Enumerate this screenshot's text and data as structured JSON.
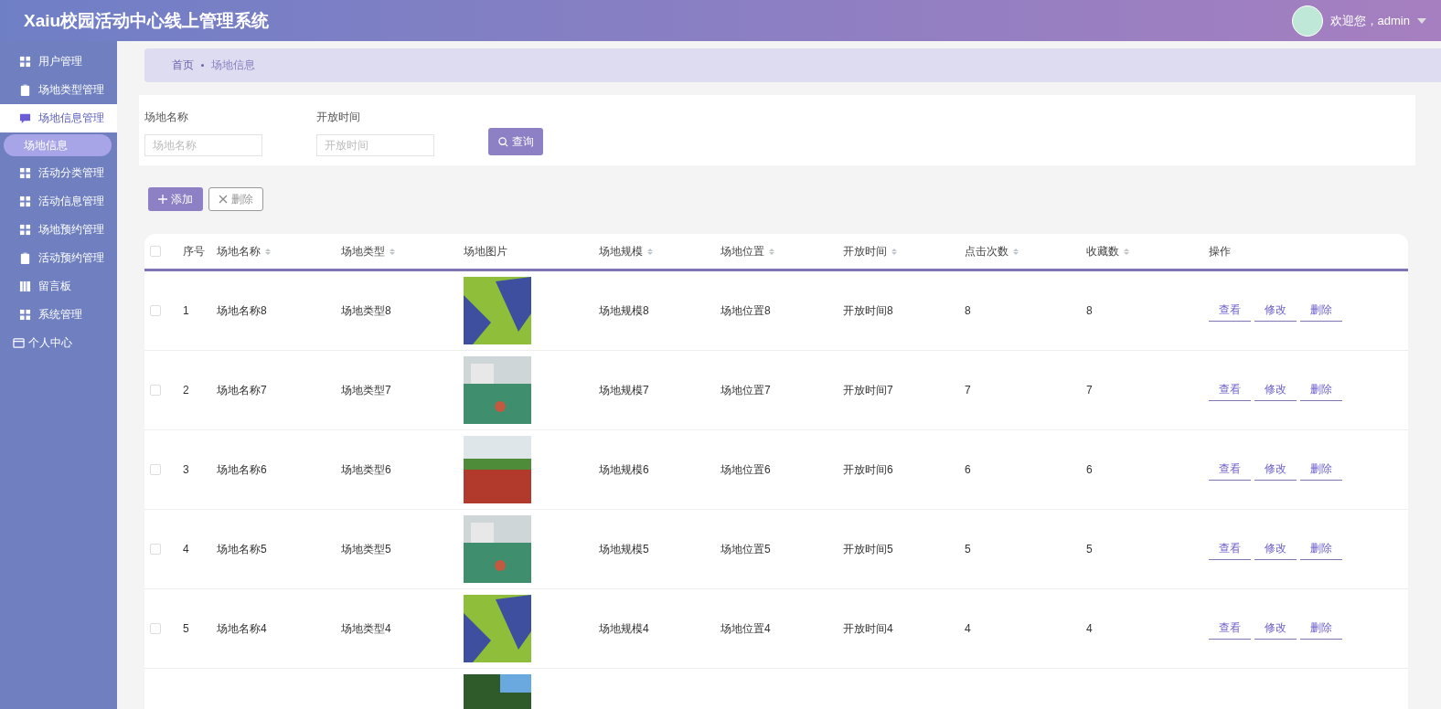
{
  "header": {
    "title": "Xaiu校园活动中心线上管理系统",
    "user": "欢迎您，admin"
  },
  "sidebar": {
    "items": [
      {
        "label": "用户管理",
        "kind": "grid",
        "selected": false
      },
      {
        "label": "场地类型管理",
        "kind": "clipboard",
        "selected": false
      },
      {
        "label": "场地信息管理",
        "kind": "chat",
        "selected": true,
        "children": [
          {
            "label": "场地信息",
            "selected": true
          }
        ]
      },
      {
        "label": "活动分类管理",
        "kind": "grid",
        "selected": false
      },
      {
        "label": "活动信息管理",
        "kind": "grid",
        "selected": false
      },
      {
        "label": "场地预约管理",
        "kind": "grid",
        "selected": false
      },
      {
        "label": "活动预约管理",
        "kind": "clipboard",
        "selected": false
      },
      {
        "label": "留言板",
        "kind": "book",
        "selected": false
      },
      {
        "label": "系统管理",
        "kind": "grid",
        "selected": false
      },
      {
        "label": "个人中心",
        "kind": "card",
        "selected": false
      }
    ]
  },
  "breadcrumb": [
    "首页",
    "场地信息"
  ],
  "search": {
    "fields": [
      {
        "label": "场地名称",
        "placeholder": "场地名称"
      },
      {
        "label": "开放时间",
        "placeholder": "开放时间"
      }
    ],
    "button": "查询"
  },
  "actions": [
    {
      "label": "添加",
      "kind": "add"
    },
    {
      "label": "删除",
      "kind": "delete"
    }
  ],
  "table": {
    "all_checked": false,
    "columns": [
      {
        "label": "序号",
        "sortable": false
      },
      {
        "label": "场地名称",
        "sortable": true
      },
      {
        "label": "场地类型",
        "sortable": true
      },
      {
        "label": "场地图片",
        "sortable": false
      },
      {
        "label": "场地规模",
        "sortable": true
      },
      {
        "label": "场地位置",
        "sortable": true
      },
      {
        "label": "开放时间",
        "sortable": true
      },
      {
        "label": "点击次数",
        "sortable": true
      },
      {
        "label": "收藏数",
        "sortable": true
      },
      {
        "label": "操作",
        "sortable": false
      }
    ],
    "rows": [
      {
        "checked": false,
        "cells": [
          "1",
          "场地名称8",
          "场地类型8",
          "",
          "场地规模8",
          "场地位置8",
          "开放时间8",
          "8",
          "8"
        ],
        "actions": [
          "查看",
          "修改",
          "删除"
        ]
      },
      {
        "checked": false,
        "cells": [
          "2",
          "场地名称7",
          "场地类型7",
          "",
          "场地规模7",
          "场地位置7",
          "开放时间7",
          "7",
          "7"
        ],
        "actions": [
          "查看",
          "修改",
          "删除"
        ]
      },
      {
        "checked": false,
        "cells": [
          "3",
          "场地名称6",
          "场地类型6",
          "",
          "场地规模6",
          "场地位置6",
          "开放时间6",
          "6",
          "6"
        ],
        "actions": [
          "查看",
          "修改",
          "删除"
        ]
      },
      {
        "checked": false,
        "cells": [
          "4",
          "场地名称5",
          "场地类型5",
          "",
          "场地规模5",
          "场地位置5",
          "开放时间5",
          "5",
          "5"
        ],
        "actions": [
          "查看",
          "修改",
          "删除"
        ]
      },
      {
        "checked": false,
        "cells": [
          "5",
          "场地名称4",
          "场地类型4",
          "",
          "场地规模4",
          "场地位置4",
          "开放时间4",
          "4",
          "4"
        ],
        "actions": [
          "查看",
          "修改",
          "删除"
        ]
      }
    ]
  }
}
